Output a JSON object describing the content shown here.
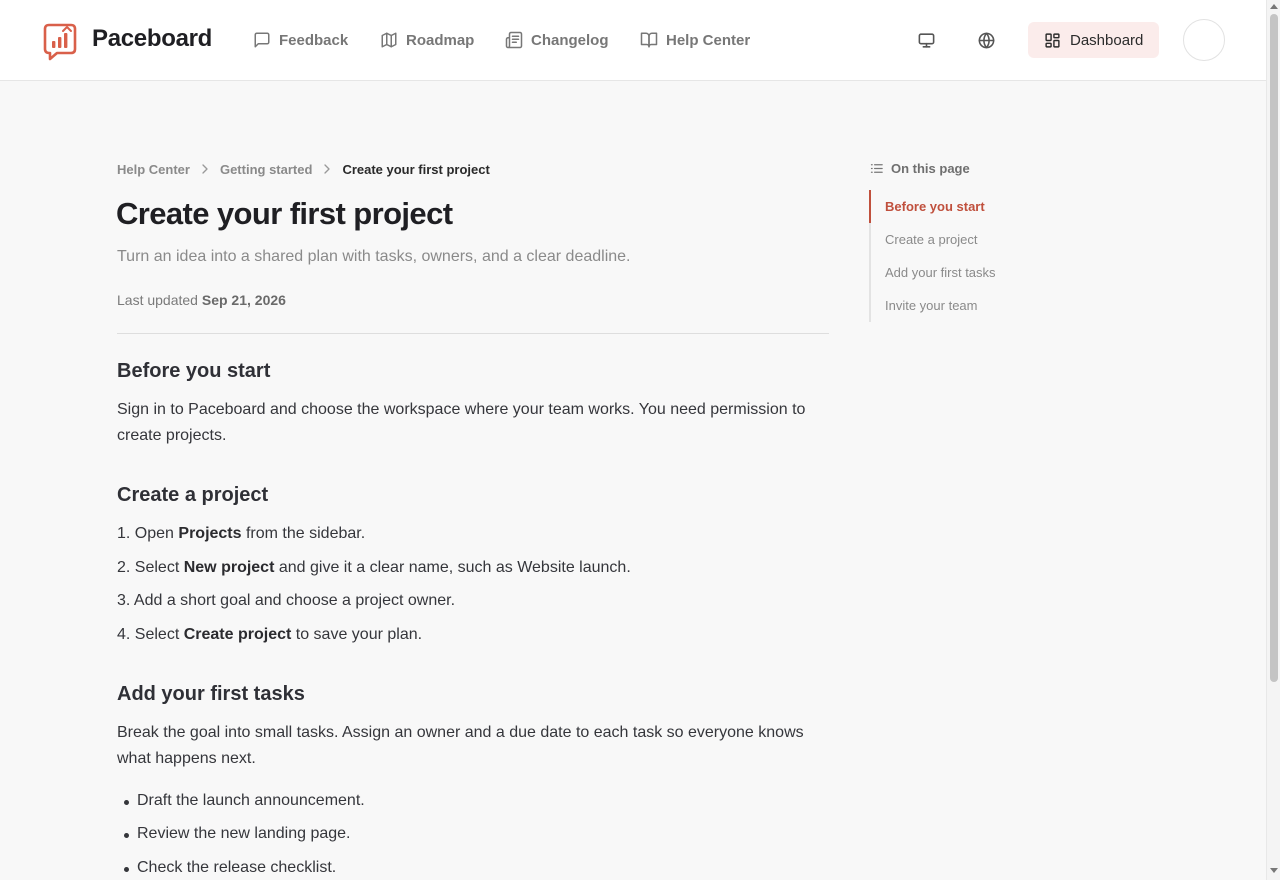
{
  "header": {
    "brand": "Paceboard",
    "nav": [
      {
        "label": "Feedback",
        "icon": "message-square-icon"
      },
      {
        "label": "Roadmap",
        "icon": "map-icon"
      },
      {
        "label": "Changelog",
        "icon": "newspaper-icon"
      },
      {
        "label": "Help Center",
        "icon": "book-open-icon"
      }
    ],
    "dashboard_label": "Dashboard"
  },
  "breadcrumb": [
    "Help Center",
    "Getting started",
    "Create your first project"
  ],
  "article": {
    "title": "Create your first project",
    "subtitle": "Turn an idea into a shared plan with tasks, owners, and a clear deadline.",
    "updated_prefix": "Last updated",
    "updated_date": "Sep 21, 2026",
    "sections": {
      "before": {
        "heading": "Before you start",
        "body": "Sign in to Paceboard and choose the workspace where your team works. You need permission to create projects."
      },
      "create": {
        "heading": "Create a project",
        "steps": [
          {
            "num": "1.",
            "pre": "Open",
            "bold": "Projects",
            "post": "from the sidebar."
          },
          {
            "num": "2.",
            "pre": "Select",
            "bold": "New project",
            "post": "and give it a clear name, such as Website launch."
          },
          {
            "num": "3.",
            "pre": "Add a short goal and choose a project owner.",
            "bold": "",
            "post": ""
          },
          {
            "num": "4.",
            "pre": "Select",
            "bold": "Create project",
            "post": "to save your plan."
          }
        ]
      },
      "tasks": {
        "heading": "Add your first tasks",
        "body": "Break the goal into small tasks. Assign an owner and a due date to each task so everyone knows what happens next.",
        "bullets": [
          "Draft the launch announcement.",
          "Review the new landing page.",
          "Check the release checklist."
        ]
      }
    }
  },
  "toc": {
    "heading": "On this page",
    "items": [
      "Before you start",
      "Create a project",
      "Add your first tasks",
      "Invite your team"
    ],
    "active_index": 0
  },
  "colors": {
    "accent": "#c0503d",
    "dashboard_bg": "#fbeceb",
    "logo": "#d9604a"
  }
}
